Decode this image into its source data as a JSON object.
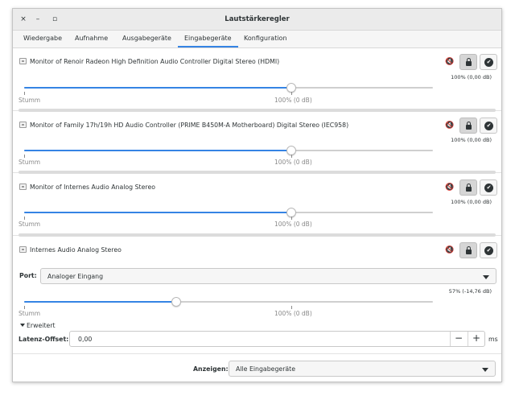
{
  "window": {
    "title": "Lautstärkeregler",
    "controls": {
      "close": "×",
      "minimize": "–",
      "maximize": "▫"
    }
  },
  "tabs": [
    {
      "label": "Wiedergabe"
    },
    {
      "label": "Aufnahme"
    },
    {
      "label": "Ausgabegeräte"
    },
    {
      "label": "Eingabegeräte",
      "active": true
    },
    {
      "label": "Konfiguration"
    }
  ],
  "devices": [
    {
      "name": "Monitor of Renoir Radeon High Definition Audio Controller Digital Stereo (HDMI)",
      "volume_text": "100% (0,00 dB)",
      "volume_fraction": 1.0,
      "mute_label": "Stumm",
      "marker_label": "100% (0 dB)"
    },
    {
      "name": "Monitor of Family 17h/19h HD Audio Controller (PRIME B450M-A Motherboard) Digital Stereo (IEC958)",
      "volume_text": "100% (0,00 dB)",
      "volume_fraction": 1.0,
      "mute_label": "Stumm",
      "marker_label": "100% (0 dB)"
    },
    {
      "name": "Monitor of Internes Audio Analog Stereo",
      "volume_text": "100% (0,00 dB)",
      "volume_fraction": 1.0,
      "mute_label": "Stumm",
      "marker_label": "100% (0 dB)"
    },
    {
      "name": "Internes Audio Analog Stereo",
      "volume_text": "57% (-14,76 dB)",
      "volume_fraction": 0.57,
      "mute_label": "Stumm",
      "marker_label": "100% (0 dB)",
      "port_label": "Port:",
      "port_value": "Analoger Eingang",
      "advanced_label": "Erweitert",
      "latency_label": "Latenz-Offset:",
      "latency_value": "0,00",
      "latency_unit": "ms",
      "minus": "−",
      "plus": "+"
    }
  ],
  "footer": {
    "show_label": "Anzeigen:",
    "show_value": "Alle Eingabegeräte"
  },
  "icons": {
    "mute": "🔇",
    "check": "✔"
  },
  "colors": {
    "accent": "#3584e4"
  }
}
